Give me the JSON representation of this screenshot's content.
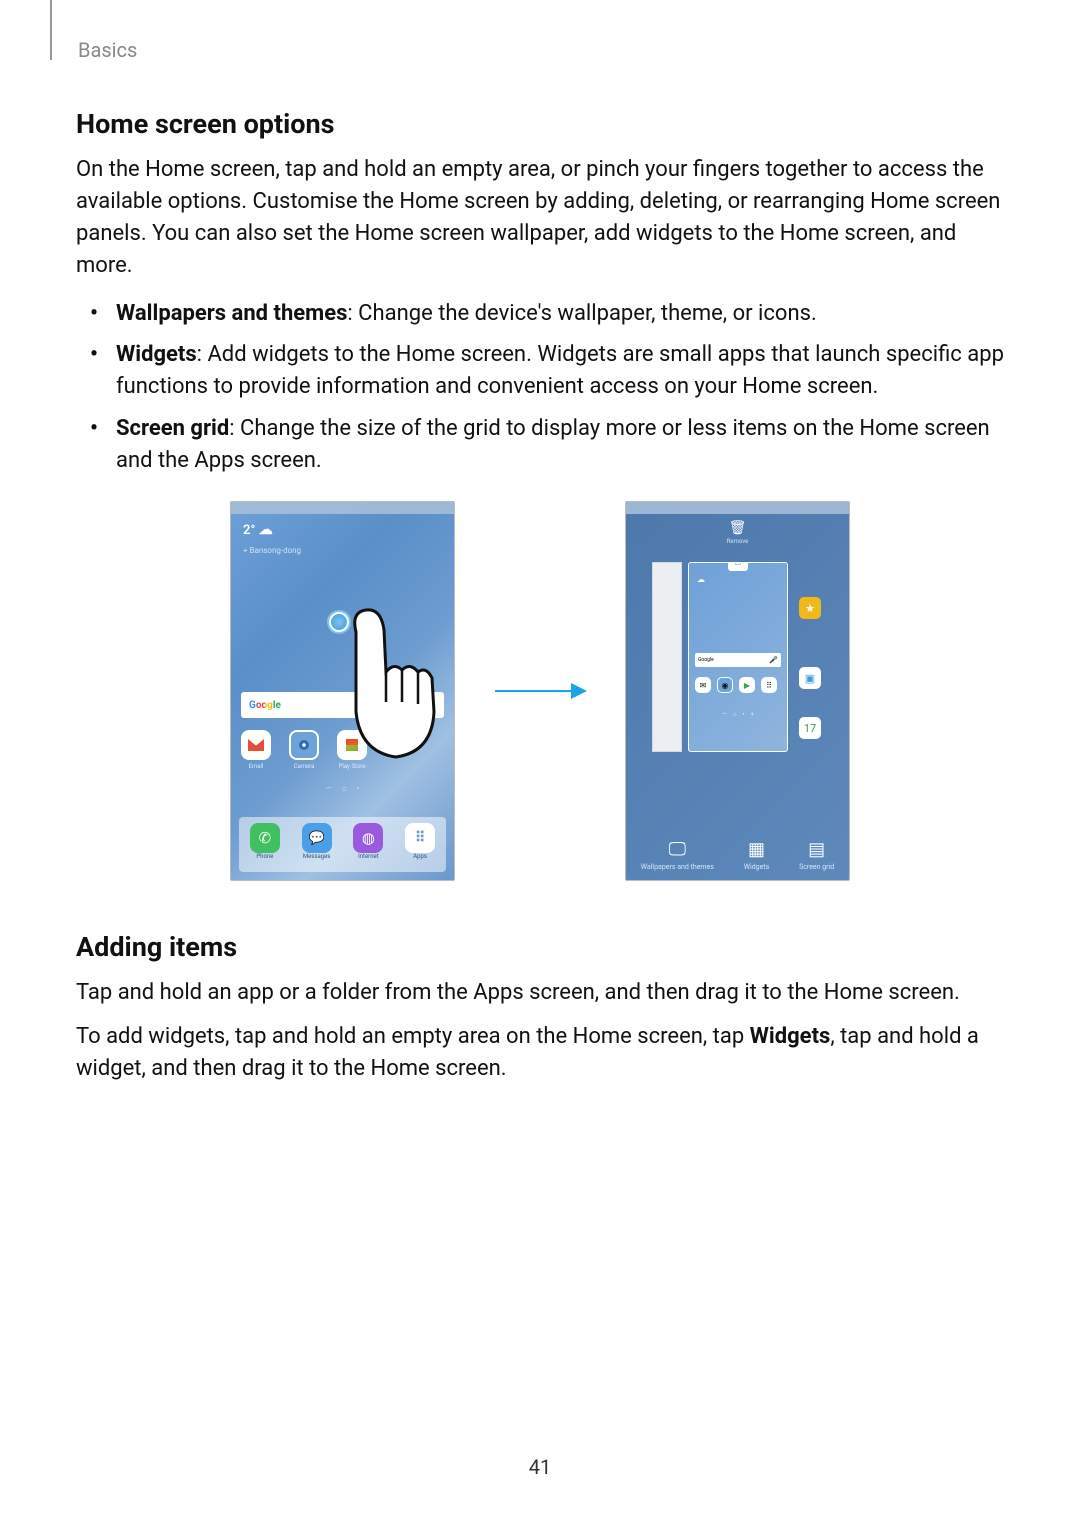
{
  "breadcrumb": "Basics",
  "page_number": "41",
  "section1": {
    "heading": "Home screen options",
    "intro": "On the Home screen, tap and hold an empty area, or pinch your fingers together to access the available options. Customise the Home screen by adding, deleting, or rearranging Home screen panels. You can also set the Home screen wallpaper, add widgets to the Home screen, and more.",
    "bullets": [
      {
        "term": "Wallpapers and themes",
        "desc": ": Change the device's wallpaper, theme, or icons."
      },
      {
        "term": "Widgets",
        "desc": ": Add widgets to the Home screen. Widgets are small apps that launch specific app functions to provide information and convenient access on your Home screen."
      },
      {
        "term": "Screen grid",
        "desc": ": Change the size of the grid to display more or less items on the Home screen and the Apps screen."
      }
    ]
  },
  "figure": {
    "left_phone": {
      "temp": "2°",
      "location": "Bansong-dong",
      "search_logo": "Google",
      "apps": [
        "Email",
        "Camera",
        "Play Store"
      ],
      "dock": [
        "Phone",
        "Messages",
        "Internet",
        "Apps"
      ]
    },
    "right_phone": {
      "trash_label": "Remove",
      "search_logo": "Google",
      "options": [
        "Wallpapers and themes",
        "Widgets",
        "Screen grid"
      ]
    }
  },
  "section2": {
    "heading": "Adding items",
    "p1": "Tap and hold an app or a folder from the Apps screen, and then drag it to the Home screen.",
    "p2_a": "To add widgets, tap and hold an empty area on the Home screen, tap ",
    "p2_bold": "Widgets",
    "p2_b": ", tap and hold a widget, and then drag it to the Home screen."
  }
}
